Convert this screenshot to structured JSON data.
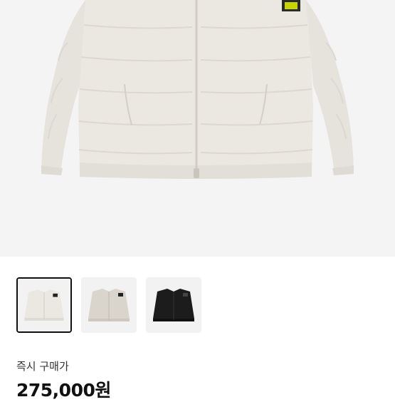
{
  "product": {
    "buy_label": "즉시 구매가",
    "price": "275,000원"
  },
  "thumbnails": [
    {
      "color": "white",
      "selected": true
    },
    {
      "color": "beige",
      "selected": false
    },
    {
      "color": "black",
      "selected": false
    }
  ],
  "colors": {
    "jacket_white": "#ebe8e2",
    "jacket_beige": "#d9d4cc",
    "jacket_black": "#1c1c1c",
    "badge_green": "#c8d400"
  }
}
